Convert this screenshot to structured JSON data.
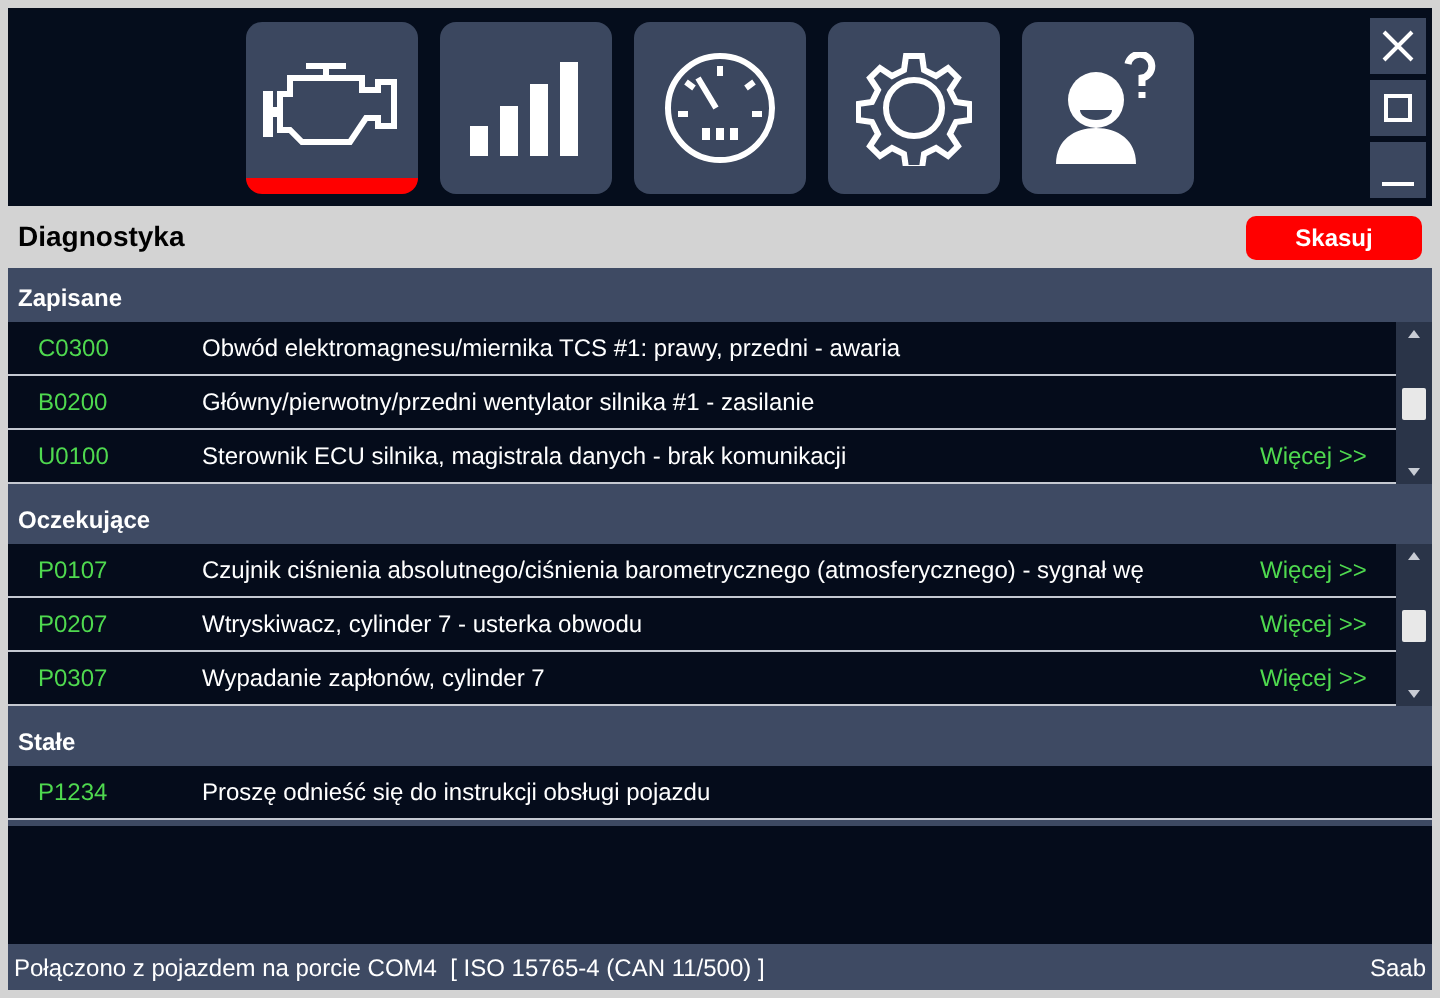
{
  "toolbar": {
    "items": [
      {
        "kind": "engine",
        "selected": true
      },
      {
        "kind": "signal",
        "selected": false
      },
      {
        "kind": "gauge",
        "selected": false
      },
      {
        "kind": "gear",
        "selected": false
      },
      {
        "kind": "help",
        "selected": false
      }
    ]
  },
  "header": {
    "title": "Diagnostyka",
    "clear_button": "Skasuj"
  },
  "sections": [
    {
      "title": "Zapisane",
      "scrollable": true,
      "rows": [
        {
          "code": "C0300",
          "description": "Obwód elektromagnesu/miernika TCS #1: prawy, przedni - awaria"
        },
        {
          "code": "B0200",
          "description": "Główny/pierwotny/przedni wentylator silnika #1 - zasilanie"
        },
        {
          "code": "U0100",
          "description": "Sterownik ECU silnika, magistrala danych - brak komunikacji",
          "more": "Więcej >>"
        }
      ]
    },
    {
      "title": "Oczekujące",
      "scrollable": true,
      "rows": [
        {
          "code": "P0107",
          "description": "Czujnik ciśnienia absolutnego/ciśnienia barometrycznego (atmosferycznego) - sygnał wę",
          "more": "Więcej >>"
        },
        {
          "code": "P0207",
          "description": "Wtryskiwacz, cylinder 7 - usterka obwodu",
          "more": "Więcej >>"
        },
        {
          "code": "P0307",
          "description": "Wypadanie zapłonów, cylinder 7",
          "more": "Więcej >>"
        }
      ]
    },
    {
      "title": "Stałe",
      "scrollable": false,
      "rows": [
        {
          "code": "P1234",
          "description": "Proszę odnieść się do instrukcji obsługi pojazdu"
        }
      ]
    }
  ],
  "status_bar": {
    "connection": "Połączono z pojazdem na porcie COM4  [ ISO 15765-4 (CAN 11/500) ]",
    "vehicle": "Saab"
  }
}
